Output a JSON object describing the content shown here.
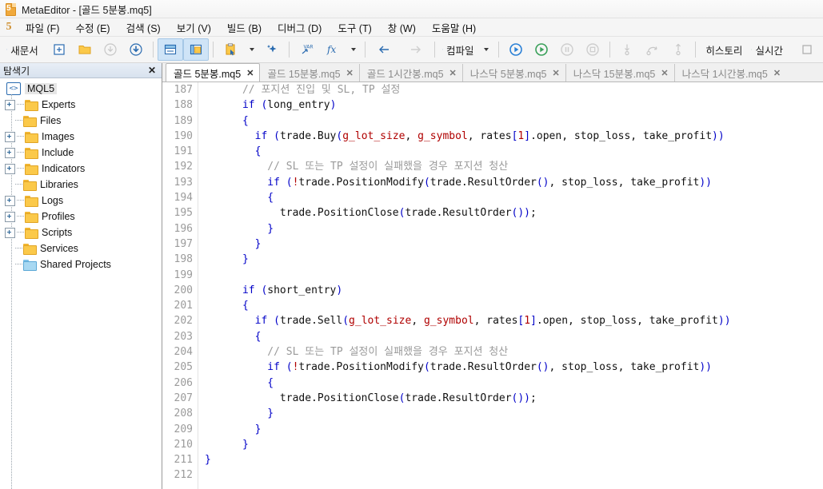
{
  "window": {
    "app_name": "MetaEditor",
    "title": "MetaEditor - [골드 5분봉.mq5]",
    "logo_text": "5"
  },
  "menubar": {
    "items": [
      {
        "label": "파일 (F)"
      },
      {
        "label": "수정 (E)"
      },
      {
        "label": "검색 (S)"
      },
      {
        "label": "보기 (V)"
      },
      {
        "label": "빌드 (B)"
      },
      {
        "label": "디버그 (D)"
      },
      {
        "label": "도구 (T)"
      },
      {
        "label": "창 (W)"
      },
      {
        "label": "도움말 (H)"
      }
    ]
  },
  "toolbar": {
    "new_document_label": "새문서",
    "compile_label": "컴파일",
    "history_label": "히스토리",
    "realtime_label": "실시간",
    "icons": {
      "new_document": "new-document-icon",
      "new_file": "new-file-icon",
      "open_folder": "open-folder-icon",
      "save": "save-icon",
      "save_all": "save-all-icon",
      "toggle_panels": "toggle-panels-icon",
      "toggle_navigator": "toggle-navigator-icon",
      "clipboard": "clipboard-icon",
      "sparkle": "sparkle-ai-icon",
      "variables": "variables-icon",
      "functions": "functions-icon",
      "back": "back-arrow-icon",
      "forward": "forward-arrow-icon",
      "compile": "compile-icon",
      "debug_play": "debug-play-icon",
      "play": "play-icon",
      "pause": "pause-icon",
      "stop": "stop-icon",
      "step_into": "step-into-icon",
      "step_over": "step-over-icon",
      "step_out": "step-out-icon",
      "history": "history-icon",
      "realtime": "realtime-icon",
      "panel_toggle": "panel-toggle-icon"
    }
  },
  "navigator": {
    "title": "탐색기",
    "close_label": "✕",
    "root": {
      "label": "MQL5",
      "icon": "mql5-root-icon"
    },
    "items": [
      {
        "label": "Experts",
        "expandable": true,
        "color": "yellow"
      },
      {
        "label": "Files",
        "expandable": false,
        "color": "yellow"
      },
      {
        "label": "Images",
        "expandable": true,
        "color": "yellow"
      },
      {
        "label": "Include",
        "expandable": true,
        "color": "yellow"
      },
      {
        "label": "Indicators",
        "expandable": true,
        "color": "yellow"
      },
      {
        "label": "Libraries",
        "expandable": false,
        "color": "yellow"
      },
      {
        "label": "Logs",
        "expandable": true,
        "color": "yellow"
      },
      {
        "label": "Profiles",
        "expandable": true,
        "color": "yellow"
      },
      {
        "label": "Scripts",
        "expandable": true,
        "color": "yellow"
      },
      {
        "label": "Services",
        "expandable": false,
        "color": "yellow"
      },
      {
        "label": "Shared Projects",
        "expandable": false,
        "color": "blue"
      }
    ]
  },
  "editor": {
    "tabs": [
      {
        "label": "골드 5분봉.mq5",
        "active": true
      },
      {
        "label": "골드 15분봉.mq5",
        "active": false
      },
      {
        "label": "골드 1시간봉.mq5",
        "active": false
      },
      {
        "label": "나스닥 5분봉.mq5",
        "active": false
      },
      {
        "label": "나스닥 15분봉.mq5",
        "active": false
      },
      {
        "label": "나스닥 1시간봉.mq5",
        "active": false
      }
    ],
    "close_glyph": "✕",
    "first_line_number": 187,
    "line_numbers": [
      187,
      188,
      189,
      190,
      191,
      192,
      193,
      194,
      195,
      196,
      197,
      198,
      199,
      200,
      201,
      202,
      203,
      204,
      205,
      206,
      207,
      208,
      209,
      210,
      211,
      212
    ],
    "lines": [
      {
        "n": 187,
        "tokens": [
          {
            "t": "      ",
            "c": "pl"
          },
          {
            "t": "// 포지션 진입 및 SL, TP 설정",
            "c": "cm"
          }
        ]
      },
      {
        "n": 188,
        "tokens": [
          {
            "t": "      ",
            "c": "pl"
          },
          {
            "t": "if",
            "c": "k"
          },
          {
            "t": " ",
            "c": "pl"
          },
          {
            "t": "(",
            "c": "k"
          },
          {
            "t": "long_entry",
            "c": "pl"
          },
          {
            "t": ")",
            "c": "k"
          }
        ]
      },
      {
        "n": 189,
        "tokens": [
          {
            "t": "      ",
            "c": "pl"
          },
          {
            "t": "{",
            "c": "k"
          }
        ]
      },
      {
        "n": 190,
        "tokens": [
          {
            "t": "        ",
            "c": "pl"
          },
          {
            "t": "if",
            "c": "k"
          },
          {
            "t": " ",
            "c": "pl"
          },
          {
            "t": "(",
            "c": "k"
          },
          {
            "t": "trade.Buy",
            "c": "pl"
          },
          {
            "t": "(",
            "c": "k"
          },
          {
            "t": "g_lot_size",
            "c": "id"
          },
          {
            "t": ", ",
            "c": "pl"
          },
          {
            "t": "g_symbol",
            "c": "id"
          },
          {
            "t": ", rates",
            "c": "pl"
          },
          {
            "t": "[",
            "c": "k"
          },
          {
            "t": "1",
            "c": "num"
          },
          {
            "t": "]",
            "c": "k"
          },
          {
            "t": ".open, stop_loss, take_profit",
            "c": "pl"
          },
          {
            "t": "))",
            "c": "k"
          }
        ]
      },
      {
        "n": 191,
        "tokens": [
          {
            "t": "        ",
            "c": "pl"
          },
          {
            "t": "{",
            "c": "k"
          }
        ]
      },
      {
        "n": 192,
        "tokens": [
          {
            "t": "          ",
            "c": "pl"
          },
          {
            "t": "// SL 또는 TP 설정이 실패했을 경우 포지션 청산",
            "c": "cm"
          }
        ]
      },
      {
        "n": 193,
        "tokens": [
          {
            "t": "          ",
            "c": "pl"
          },
          {
            "t": "if",
            "c": "k"
          },
          {
            "t": " ",
            "c": "pl"
          },
          {
            "t": "(",
            "c": "k"
          },
          {
            "t": "!",
            "c": "id"
          },
          {
            "t": "trade.PositionModify",
            "c": "pl"
          },
          {
            "t": "(",
            "c": "k"
          },
          {
            "t": "trade.ResultOrder",
            "c": "pl"
          },
          {
            "t": "()",
            "c": "k"
          },
          {
            "t": ", stop_loss, take_profit",
            "c": "pl"
          },
          {
            "t": "))",
            "c": "k"
          }
        ]
      },
      {
        "n": 194,
        "tokens": [
          {
            "t": "          ",
            "c": "pl"
          },
          {
            "t": "{",
            "c": "k"
          }
        ]
      },
      {
        "n": 195,
        "tokens": [
          {
            "t": "            ",
            "c": "pl"
          },
          {
            "t": "trade.PositionClose",
            "c": "pl"
          },
          {
            "t": "(",
            "c": "k"
          },
          {
            "t": "trade.ResultOrder",
            "c": "pl"
          },
          {
            "t": "())",
            "c": "k"
          },
          {
            "t": ";",
            "c": "pl"
          }
        ]
      },
      {
        "n": 196,
        "tokens": [
          {
            "t": "          ",
            "c": "pl"
          },
          {
            "t": "}",
            "c": "k"
          }
        ]
      },
      {
        "n": 197,
        "tokens": [
          {
            "t": "        ",
            "c": "pl"
          },
          {
            "t": "}",
            "c": "k"
          }
        ]
      },
      {
        "n": 198,
        "tokens": [
          {
            "t": "      ",
            "c": "pl"
          },
          {
            "t": "}",
            "c": "k"
          }
        ]
      },
      {
        "n": 199,
        "tokens": [
          {
            "t": "",
            "c": "pl"
          }
        ]
      },
      {
        "n": 200,
        "tokens": [
          {
            "t": "      ",
            "c": "pl"
          },
          {
            "t": "if",
            "c": "k"
          },
          {
            "t": " ",
            "c": "pl"
          },
          {
            "t": "(",
            "c": "k"
          },
          {
            "t": "short_entry",
            "c": "pl"
          },
          {
            "t": ")",
            "c": "k"
          }
        ]
      },
      {
        "n": 201,
        "tokens": [
          {
            "t": "      ",
            "c": "pl"
          },
          {
            "t": "{",
            "c": "k"
          }
        ]
      },
      {
        "n": 202,
        "tokens": [
          {
            "t": "        ",
            "c": "pl"
          },
          {
            "t": "if",
            "c": "k"
          },
          {
            "t": " ",
            "c": "pl"
          },
          {
            "t": "(",
            "c": "k"
          },
          {
            "t": "trade.Sell",
            "c": "pl"
          },
          {
            "t": "(",
            "c": "k"
          },
          {
            "t": "g_lot_size",
            "c": "id"
          },
          {
            "t": ", ",
            "c": "pl"
          },
          {
            "t": "g_symbol",
            "c": "id"
          },
          {
            "t": ", rates",
            "c": "pl"
          },
          {
            "t": "[",
            "c": "k"
          },
          {
            "t": "1",
            "c": "num"
          },
          {
            "t": "]",
            "c": "k"
          },
          {
            "t": ".open, stop_loss, take_profit",
            "c": "pl"
          },
          {
            "t": "))",
            "c": "k"
          }
        ]
      },
      {
        "n": 203,
        "tokens": [
          {
            "t": "        ",
            "c": "pl"
          },
          {
            "t": "{",
            "c": "k"
          }
        ]
      },
      {
        "n": 204,
        "tokens": [
          {
            "t": "          ",
            "c": "pl"
          },
          {
            "t": "// SL 또는 TP 설정이 실패했을 경우 포지션 청산",
            "c": "cm"
          }
        ]
      },
      {
        "n": 205,
        "tokens": [
          {
            "t": "          ",
            "c": "pl"
          },
          {
            "t": "if",
            "c": "k"
          },
          {
            "t": " ",
            "c": "pl"
          },
          {
            "t": "(",
            "c": "k"
          },
          {
            "t": "!",
            "c": "id"
          },
          {
            "t": "trade.PositionModify",
            "c": "pl"
          },
          {
            "t": "(",
            "c": "k"
          },
          {
            "t": "trade.ResultOrder",
            "c": "pl"
          },
          {
            "t": "()",
            "c": "k"
          },
          {
            "t": ", stop_loss, take_profit",
            "c": "pl"
          },
          {
            "t": "))",
            "c": "k"
          }
        ]
      },
      {
        "n": 206,
        "tokens": [
          {
            "t": "          ",
            "c": "pl"
          },
          {
            "t": "{",
            "c": "k"
          }
        ]
      },
      {
        "n": 207,
        "tokens": [
          {
            "t": "            ",
            "c": "pl"
          },
          {
            "t": "trade.PositionClose",
            "c": "pl"
          },
          {
            "t": "(",
            "c": "k"
          },
          {
            "t": "trade.ResultOrder",
            "c": "pl"
          },
          {
            "t": "())",
            "c": "k"
          },
          {
            "t": ";",
            "c": "pl"
          }
        ]
      },
      {
        "n": 208,
        "tokens": [
          {
            "t": "          ",
            "c": "pl"
          },
          {
            "t": "}",
            "c": "k"
          }
        ]
      },
      {
        "n": 209,
        "tokens": [
          {
            "t": "        ",
            "c": "pl"
          },
          {
            "t": "}",
            "c": "k"
          }
        ]
      },
      {
        "n": 210,
        "tokens": [
          {
            "t": "      ",
            "c": "pl"
          },
          {
            "t": "}",
            "c": "k"
          }
        ]
      },
      {
        "n": 211,
        "tokens": [
          {
            "t": "}",
            "c": "k"
          }
        ]
      },
      {
        "n": 212,
        "tokens": [
          {
            "t": "",
            "c": "pl"
          }
        ]
      }
    ]
  },
  "colors": {
    "keyword": "#0000c8",
    "identifier": "#b00000",
    "comment": "#9a9a9a",
    "plain": "#111111",
    "folder_yellow": "#fbc94a",
    "folder_blue": "#a8d8f2",
    "accent_blue": "#2a6bb0",
    "logo_gold": "#cf9133"
  }
}
